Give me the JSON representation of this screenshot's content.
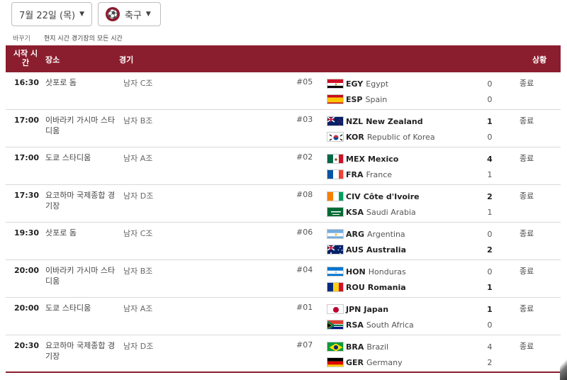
{
  "filters": {
    "date_label": "7월 22일 (목)",
    "sport_label": "축구",
    "sport_icon": "soccer-icon"
  },
  "timezone": {
    "change_label": "바꾸기",
    "description": "현지 시간 경기장의 모든 시간"
  },
  "table": {
    "headers": {
      "time": "시작 시간",
      "venue": "장소",
      "event": "경기",
      "status": "상황"
    },
    "rows": [
      {
        "time": "16:30",
        "venue": "삿포로 돔",
        "event": "남자 C조",
        "number": "#05",
        "status": "종료",
        "teams": [
          {
            "code": "EGY",
            "name": "Egypt",
            "score": "0",
            "win": false,
            "flag": "egy"
          },
          {
            "code": "ESP",
            "name": "Spain",
            "score": "0",
            "win": false,
            "flag": "esp"
          }
        ]
      },
      {
        "time": "17:00",
        "venue": "이바라키 가시마 스타디움",
        "event": "남자 B조",
        "number": "#03",
        "status": "종료",
        "teams": [
          {
            "code": "NZL",
            "name": "New Zealand",
            "score": "1",
            "win": true,
            "flag": "nzl"
          },
          {
            "code": "KOR",
            "name": "Republic of Korea",
            "score": "0",
            "win": false,
            "flag": "kor"
          }
        ]
      },
      {
        "time": "17:00",
        "venue": "도쿄 스타디움",
        "event": "남자 A조",
        "number": "#02",
        "status": "종료",
        "teams": [
          {
            "code": "MEX",
            "name": "Mexico",
            "score": "4",
            "win": true,
            "flag": "mex"
          },
          {
            "code": "FRA",
            "name": "France",
            "score": "1",
            "win": false,
            "flag": "fra"
          }
        ]
      },
      {
        "time": "17:30",
        "venue": "요코하마 국제종합 경기장",
        "event": "남자 D조",
        "number": "#08",
        "status": "종료",
        "teams": [
          {
            "code": "CIV",
            "name": "Côte d'Ivoire",
            "score": "2",
            "win": true,
            "flag": "civ"
          },
          {
            "code": "KSA",
            "name": "Saudi Arabia",
            "score": "1",
            "win": false,
            "flag": "ksa"
          }
        ]
      },
      {
        "time": "19:30",
        "venue": "삿포로 돔",
        "event": "남자 C조",
        "number": "#06",
        "status": "종료",
        "teams": [
          {
            "code": "ARG",
            "name": "Argentina",
            "score": "0",
            "win": false,
            "flag": "arg"
          },
          {
            "code": "AUS",
            "name": "Australia",
            "score": "2",
            "win": true,
            "flag": "aus"
          }
        ]
      },
      {
        "time": "20:00",
        "venue": "이바라키 가시마 스타디움",
        "event": "남자 B조",
        "number": "#04",
        "status": "종료",
        "teams": [
          {
            "code": "HON",
            "name": "Honduras",
            "score": "0",
            "win": false,
            "flag": "hon"
          },
          {
            "code": "ROU",
            "name": "Romania",
            "score": "1",
            "win": true,
            "flag": "rou"
          }
        ]
      },
      {
        "time": "20:00",
        "venue": "도쿄 스타디움",
        "event": "남자 A조",
        "number": "#01",
        "status": "종료",
        "teams": [
          {
            "code": "JPN",
            "name": "Japan",
            "score": "1",
            "win": true,
            "flag": "jpn"
          },
          {
            "code": "RSA",
            "name": "South Africa",
            "score": "0",
            "win": false,
            "flag": "rsa"
          }
        ]
      },
      {
        "time": "20:30",
        "venue": "요코하마 국제종합 경기장",
        "event": "남자 D조",
        "number": "#07",
        "status": "종료",
        "teams": [
          {
            "code": "BRA",
            "name": "Brazil",
            "score": "4",
            "win": false,
            "flag": "bra"
          },
          {
            "code": "GER",
            "name": "Germany",
            "score": "2",
            "win": false,
            "flag": "ger"
          }
        ]
      }
    ]
  }
}
